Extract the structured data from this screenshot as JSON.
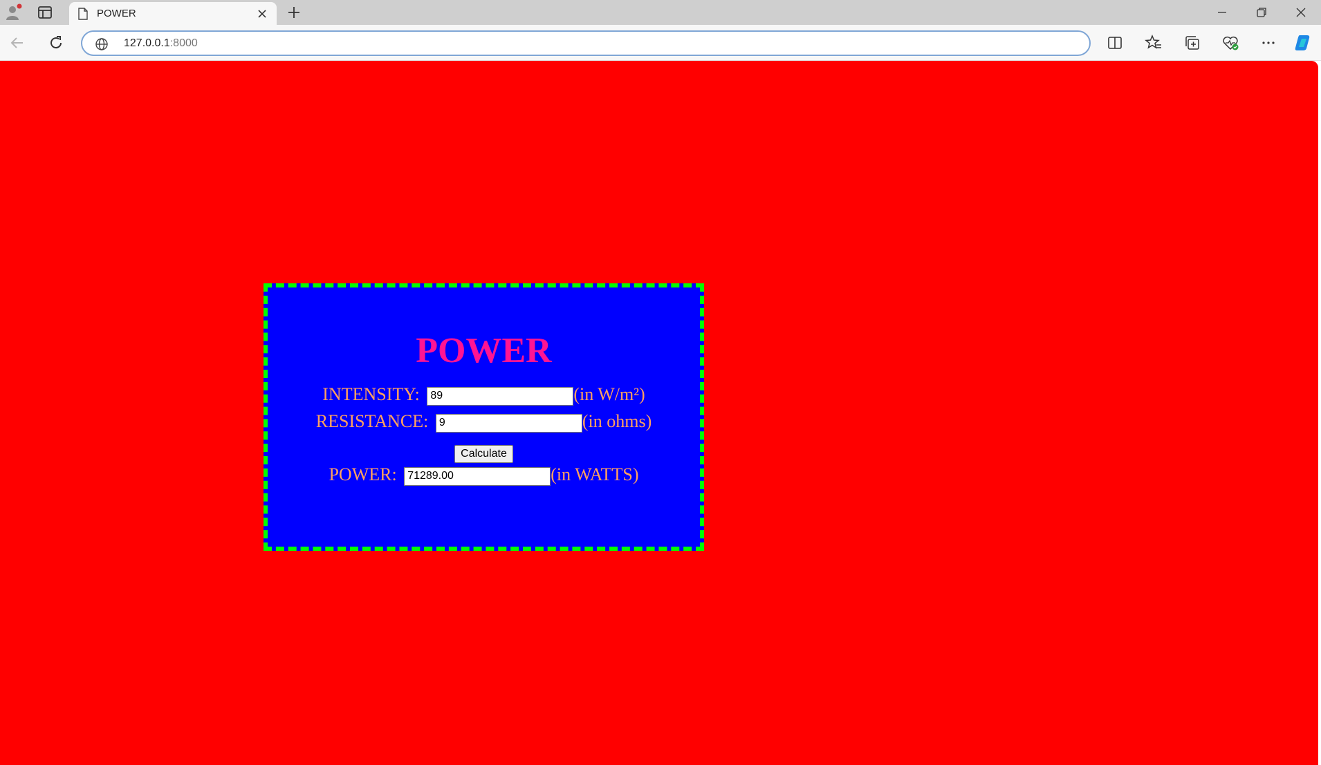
{
  "browser": {
    "tab_title": "POWER",
    "url_host": "127.0.0.1",
    "url_port": ":8000"
  },
  "page": {
    "heading": "POWER",
    "intensity_label": "INTENSITY:",
    "intensity_value": "89",
    "intensity_unit": "(in W/m²)",
    "resistance_label": "RESISTANCE:",
    "resistance_value": "9",
    "resistance_unit": "(in ohms)",
    "calculate_label": "Calculate",
    "power_label": "POWER:",
    "power_value": "71289.00",
    "power_unit": "(in WATTS)"
  },
  "colors": {
    "page_background": "#ff0000",
    "panel_background": "#0000ff",
    "panel_border": "#00ff00",
    "heading": "#ff1493",
    "label_text": "#ffa060"
  },
  "icons": [
    "profile-icon",
    "tab-actions-icon",
    "page-icon",
    "close-icon",
    "plus-icon",
    "minimize-icon",
    "restore-icon",
    "close-window-icon",
    "back-arrow-icon",
    "refresh-icon",
    "globe-icon",
    "split-screen-icon",
    "favorites-icon",
    "collections-icon",
    "browser-essentials-icon",
    "more-icon",
    "copilot-icon"
  ]
}
